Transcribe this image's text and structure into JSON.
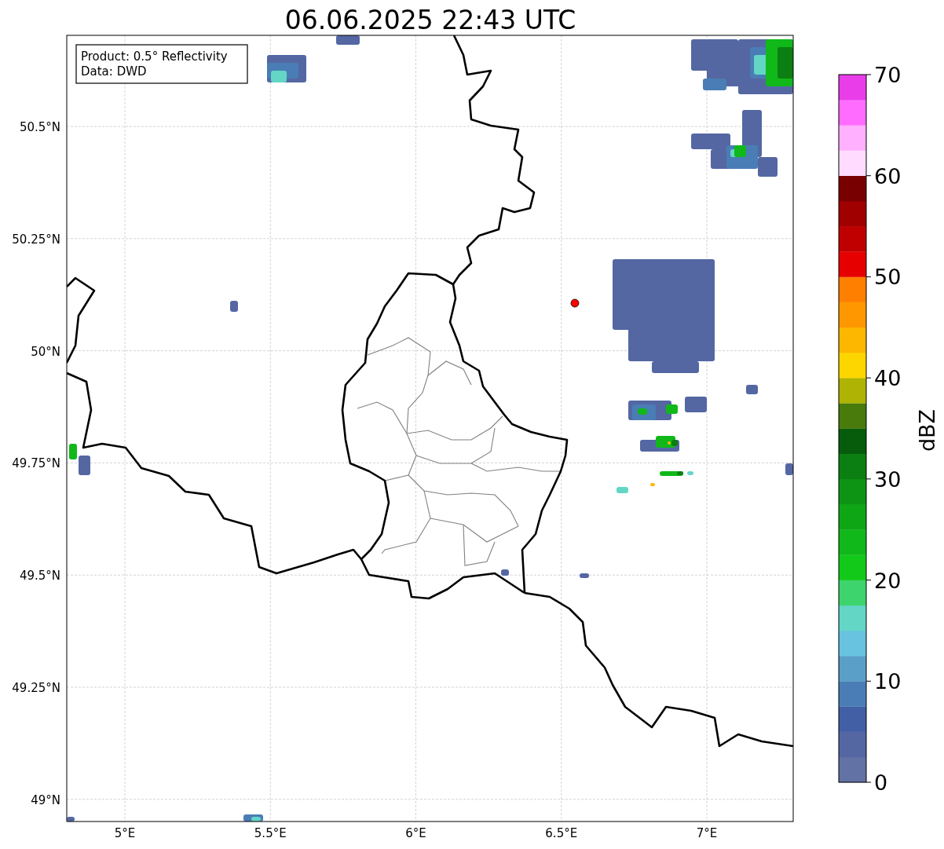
{
  "title": "06.06.2025 22:43 UTC",
  "legend": [
    "Product: 0.5° Reflectivity",
    "Data: DWD"
  ],
  "x_ticks": [
    "5°E",
    "5.5°E",
    "6°E",
    "6.5°E",
    "7°E"
  ],
  "y_ticks": [
    "50.5°N",
    "50.25°N",
    "50°N",
    "49.75°N",
    "49.5°N",
    "49.25°N",
    "49°N"
  ],
  "colorbar": {
    "label": "dBZ",
    "ticks": [
      "70",
      "60",
      "50",
      "40",
      "30",
      "20",
      "10",
      "0"
    ],
    "segments": [
      {
        "color": "#6272a4"
      },
      {
        "color": "#5467a3"
      },
      {
        "color": "#425fa5"
      },
      {
        "color": "#4a7db5"
      },
      {
        "color": "#5a9fc8"
      },
      {
        "color": "#67c3df"
      },
      {
        "color": "#63d6c6"
      },
      {
        "color": "#3dd46d"
      },
      {
        "color": "#12c91a"
      },
      {
        "color": "#10b81a"
      },
      {
        "color": "#0ea615"
      },
      {
        "color": "#0d9414"
      },
      {
        "color": "#0b7f12"
      },
      {
        "color": "#075c0c"
      },
      {
        "color": "#487a0c"
      },
      {
        "color": "#afb304"
      },
      {
        "color": "#fdd600"
      },
      {
        "color": "#feb700"
      },
      {
        "color": "#ff9800"
      },
      {
        "color": "#ff7f00"
      },
      {
        "color": "#e60000"
      },
      {
        "color": "#c00000"
      },
      {
        "color": "#a00000"
      },
      {
        "color": "#780000"
      },
      {
        "color": "#ffdcff"
      },
      {
        "color": "#ffb1ff"
      },
      {
        "color": "#ff6cff"
      },
      {
        "color": "#e83de9"
      }
    ]
  }
}
